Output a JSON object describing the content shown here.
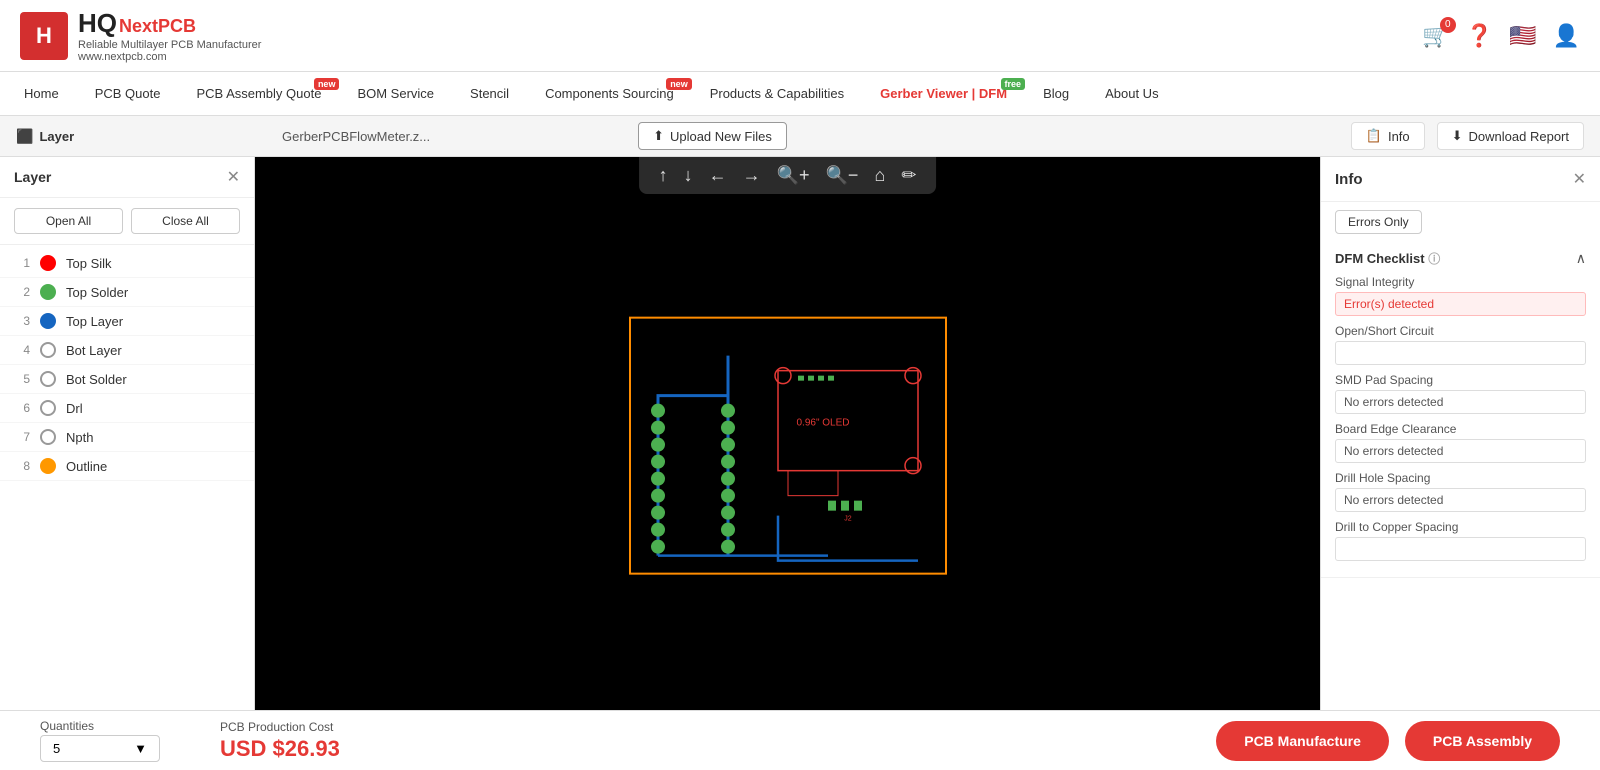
{
  "header": {
    "logo_letter": "H",
    "logo_hq": "HQ",
    "logo_next": "Next",
    "logo_pcb": "PCB",
    "tagline": "Reliable Multilayer PCB Manufacturer",
    "url": "www.nextpcb.com",
    "cart_count": "0"
  },
  "nav": {
    "items": [
      {
        "label": "Home",
        "badge": null,
        "active": false
      },
      {
        "label": "PCB Quote",
        "badge": null,
        "active": false
      },
      {
        "label": "PCB Assembly Quote",
        "badge": "new",
        "active": false
      },
      {
        "label": "BOM Service",
        "badge": null,
        "active": false
      },
      {
        "label": "Stencil",
        "badge": null,
        "active": false
      },
      {
        "label": "Components Sourcing",
        "badge": "new",
        "active": false
      },
      {
        "label": "Products & Capabilities",
        "badge": null,
        "active": false
      },
      {
        "label": "Gerber Viewer | DFM",
        "badge": "free",
        "active": true
      },
      {
        "label": "Blog",
        "badge": null,
        "active": false
      },
      {
        "label": "About Us",
        "badge": null,
        "active": false
      }
    ]
  },
  "toolbar": {
    "layer_label": "Layer",
    "file_name": "GerberPCBFlowMeter.z...",
    "upload_label": "Upload New Files",
    "info_label": "Info",
    "download_label": "Download Report"
  },
  "layer_panel": {
    "title": "Layer",
    "open_all": "Open All",
    "close_all": "Close All",
    "layers": [
      {
        "num": "1",
        "name": "Top Silk",
        "color": "#ff0000",
        "type": "dot"
      },
      {
        "num": "2",
        "name": "Top Solder",
        "color": "#4caf50",
        "type": "dot"
      },
      {
        "num": "3",
        "name": "Top Layer",
        "color": "#1565c0",
        "type": "dot"
      },
      {
        "num": "4",
        "name": "Bot Layer",
        "color": null,
        "type": "eye"
      },
      {
        "num": "5",
        "name": "Bot Solder",
        "color": null,
        "type": "eye"
      },
      {
        "num": "6",
        "name": "Drl",
        "color": null,
        "type": "eye"
      },
      {
        "num": "7",
        "name": "Npth",
        "color": null,
        "type": "eye"
      },
      {
        "num": "8",
        "name": "Outline",
        "color": "#ff9800",
        "type": "dot"
      }
    ]
  },
  "info_panel": {
    "title": "Info",
    "errors_only_label": "Errors Only",
    "dfm_title": "DFM Checklist",
    "checks": [
      {
        "label": "Signal Integrity",
        "status": "Error(s) detected",
        "is_error": true
      },
      {
        "label": "Open/Short Circuit",
        "status": "",
        "is_error": false
      },
      {
        "label": "SMD Pad Spacing",
        "status": "No errors detected",
        "is_error": false
      },
      {
        "label": "Board Edge Clearance",
        "status": "No errors detected",
        "is_error": false
      },
      {
        "label": "Drill Hole Spacing",
        "status": "No errors detected",
        "is_error": false
      },
      {
        "label": "Drill to Copper Spacing",
        "status": "",
        "is_error": false
      }
    ]
  },
  "bottom_bar": {
    "qty_label": "Quantities",
    "qty_value": "5",
    "cost_label": "PCB Production Cost",
    "cost_value": "USD $26.93",
    "btn_manufacture": "PCB Manufacture",
    "btn_assembly": "PCB Assembly"
  }
}
